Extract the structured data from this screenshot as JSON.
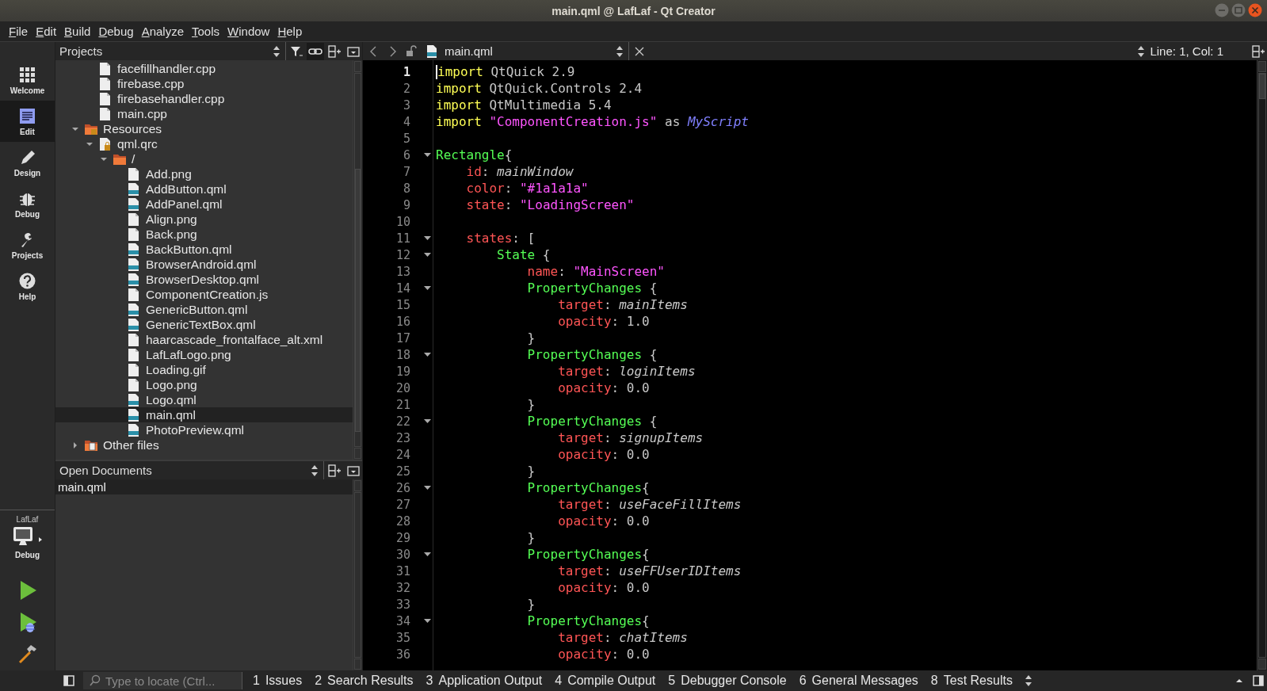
{
  "window": {
    "title": "main.qml @ LafLaf - Qt Creator"
  },
  "menu": [
    "File",
    "Edit",
    "Build",
    "Debug",
    "Analyze",
    "Tools",
    "Window",
    "Help"
  ],
  "modes": [
    {
      "label": "Welcome",
      "kind": "welcome",
      "selected": false
    },
    {
      "label": "Edit",
      "kind": "edit",
      "selected": true
    },
    {
      "label": "Design",
      "kind": "design",
      "selected": false
    },
    {
      "label": "Debug",
      "kind": "debug",
      "selected": false
    },
    {
      "label": "Projects",
      "kind": "projects",
      "selected": false
    },
    {
      "label": "Help",
      "kind": "help",
      "selected": false
    }
  ],
  "target": {
    "project": "LafLaf",
    "build": "Debug"
  },
  "projects_panel": {
    "title": "Projects",
    "tree": [
      {
        "children": [
          {
            "label": "facefillhandler.cpp",
            "kind": "file",
            "selected": false
          },
          {
            "label": "firebase.cpp",
            "kind": "file",
            "selected": false
          },
          {
            "label": "firebasehandler.cpp",
            "kind": "file",
            "selected": false
          },
          {
            "label": "main.cpp",
            "kind": "file",
            "selected": false
          }
        ]
      },
      {
        "label": "Resources",
        "kind": "resources",
        "selected": false,
        "expanded": true,
        "children": [
          {
            "label": "qml.qrc",
            "kind": "qrc",
            "selected": false,
            "expanded": true,
            "children": [
              {
                "label": "/",
                "kind": "folder",
                "selected": false,
                "expanded": true,
                "children": [
                  {
                    "label": "Add.png",
                    "kind": "file",
                    "selected": false
                  },
                  {
                    "label": "AddButton.qml",
                    "kind": "qml",
                    "selected": false
                  },
                  {
                    "label": "AddPanel.qml",
                    "kind": "qml",
                    "selected": false
                  },
                  {
                    "label": "Align.png",
                    "kind": "file",
                    "selected": false
                  },
                  {
                    "label": "Back.png",
                    "kind": "file",
                    "selected": false
                  },
                  {
                    "label": "BackButton.qml",
                    "kind": "qml",
                    "selected": false
                  },
                  {
                    "label": "BrowserAndroid.qml",
                    "kind": "qml",
                    "selected": false
                  },
                  {
                    "label": "BrowserDesktop.qml",
                    "kind": "qml",
                    "selected": false
                  },
                  {
                    "label": "ComponentCreation.js",
                    "kind": "file",
                    "selected": false
                  },
                  {
                    "label": "GenericButton.qml",
                    "kind": "qml",
                    "selected": false
                  },
                  {
                    "label": "GenericTextBox.qml",
                    "kind": "qml",
                    "selected": false
                  },
                  {
                    "label": "haarcascade_frontalface_alt.xml",
                    "kind": "file",
                    "selected": false
                  },
                  {
                    "label": "LafLafLogo.png",
                    "kind": "file",
                    "selected": false
                  },
                  {
                    "label": "Loading.gif",
                    "kind": "file",
                    "selected": false
                  },
                  {
                    "label": "Logo.png",
                    "kind": "file",
                    "selected": false
                  },
                  {
                    "label": "Logo.qml",
                    "kind": "qml",
                    "selected": false
                  },
                  {
                    "label": "main.qml",
                    "kind": "qml",
                    "selected": true
                  },
                  {
                    "label": "PhotoPreview.qml",
                    "kind": "qml",
                    "selected": false
                  }
                ]
              }
            ]
          }
        ]
      },
      {
        "label": "Other files",
        "kind": "other",
        "selected": false,
        "expanded": false
      }
    ]
  },
  "open_documents": {
    "title": "Open Documents",
    "items": [
      {
        "label": "main.qml",
        "selected": true
      }
    ]
  },
  "editor": {
    "file": "main.qml",
    "position": "Line: 1, Col: 1",
    "lines": [
      {
        "number": "1",
        "current": true,
        "fold": false,
        "segments": [
          {
            "text": "import",
            "color": "#ffff55"
          },
          {
            "text": " QtQuick 2.9",
            "color": "#c8c8c8"
          }
        ]
      },
      {
        "number": "2",
        "current": false,
        "fold": false,
        "segments": [
          {
            "text": "import",
            "color": "#ffff55"
          },
          {
            "text": " QtQuick.Controls 2.4",
            "color": "#c8c8c8"
          }
        ]
      },
      {
        "number": "3",
        "current": false,
        "fold": false,
        "segments": [
          {
            "text": "import",
            "color": "#ffff55"
          },
          {
            "text": " QtMultimedia 5.4",
            "color": "#c8c8c8"
          }
        ]
      },
      {
        "number": "4",
        "current": false,
        "fold": false,
        "segments": [
          {
            "text": "import",
            "color": "#ffff55"
          },
          {
            "text": " \"ComponentCreation.js\"",
            "color": "#ff55ff"
          },
          {
            "text": " as ",
            "color": "#c8c8c8"
          },
          {
            "text": "*MyScript*",
            "color": "#8080ff"
          }
        ]
      },
      {
        "number": "5",
        "current": false,
        "fold": false
      },
      {
        "number": "6",
        "current": false,
        "fold": true,
        "segments": [
          {
            "text": "Rectangle",
            "color": "#55ff55"
          },
          {
            "text": "{",
            "color": "#c8c8c8"
          }
        ]
      },
      {
        "number": "7",
        "current": false,
        "fold": false,
        "segments": [
          {
            "text": "    id",
            "color": "#ff5555"
          },
          {
            "text": ": *mainWindow*",
            "color": "#c8c8c8"
          }
        ]
      },
      {
        "number": "8",
        "current": false,
        "fold": false,
        "segments": [
          {
            "text": "    color",
            "color": "#ff5555"
          },
          {
            "text": ":",
            "color": "#c8c8c8"
          },
          {
            "text": " \"#1a1a1a\"",
            "color": "#ff55ff"
          }
        ]
      },
      {
        "number": "9",
        "current": false,
        "fold": false,
        "segments": [
          {
            "text": "    state",
            "color": "#ff5555"
          },
          {
            "text": ":",
            "color": "#c8c8c8"
          },
          {
            "text": " \"LoadingScreen\"",
            "color": "#ff55ff"
          }
        ]
      },
      {
        "number": "10",
        "current": false,
        "fold": false
      },
      {
        "number": "11",
        "current": false,
        "fold": true,
        "segments": [
          {
            "text": "    states",
            "color": "#ff5555"
          },
          {
            "text": ": [",
            "color": "#c8c8c8"
          }
        ]
      },
      {
        "number": "12",
        "current": false,
        "fold": true,
        "segments": [
          {
            "text": "        State",
            "color": "#55ff55"
          },
          {
            "text": " {",
            "color": "#c8c8c8"
          }
        ]
      },
      {
        "number": "13",
        "current": false,
        "fold": false,
        "segments": [
          {
            "text": "            name",
            "color": "#ff5555"
          },
          {
            "text": ":",
            "color": "#c8c8c8"
          },
          {
            "text": " \"MainScreen\"",
            "color": "#ff55ff"
          }
        ]
      },
      {
        "number": "14",
        "current": false,
        "fold": true,
        "segments": [
          {
            "text": "            PropertyChanges",
            "color": "#55ff55"
          },
          {
            "text": " {",
            "color": "#c8c8c8"
          }
        ]
      },
      {
        "number": "15",
        "current": false,
        "fold": false,
        "segments": [
          {
            "text": "                target",
            "color": "#ff5555"
          },
          {
            "text": ": *mainItems*",
            "color": "#c8c8c8"
          }
        ]
      },
      {
        "number": "16",
        "current": false,
        "fold": false,
        "segments": [
          {
            "text": "                opacity",
            "color": "#ff5555"
          },
          {
            "text": ": 1.0",
            "color": "#c8c8c8"
          }
        ]
      },
      {
        "number": "17",
        "current": false,
        "fold": false,
        "segments": [
          {
            "text": "            }",
            "color": "#c8c8c8"
          }
        ]
      },
      {
        "number": "18",
        "current": false,
        "fold": true,
        "segments": [
          {
            "text": "            PropertyChanges",
            "color": "#55ff55"
          },
          {
            "text": " {",
            "color": "#c8c8c8"
          }
        ]
      },
      {
        "number": "19",
        "current": false,
        "fold": false,
        "segments": [
          {
            "text": "                target",
            "color": "#ff5555"
          },
          {
            "text": ": *loginItems*",
            "color": "#c8c8c8"
          }
        ]
      },
      {
        "number": "20",
        "current": false,
        "fold": false,
        "segments": [
          {
            "text": "                opacity",
            "color": "#ff5555"
          },
          {
            "text": ": 0.0",
            "color": "#c8c8c8"
          }
        ]
      },
      {
        "number": "21",
        "current": false,
        "fold": false,
        "segments": [
          {
            "text": "            }",
            "color": "#c8c8c8"
          }
        ]
      },
      {
        "number": "22",
        "current": false,
        "fold": true,
        "segments": [
          {
            "text": "            PropertyChanges",
            "color": "#55ff55"
          },
          {
            "text": " {",
            "color": "#c8c8c8"
          }
        ]
      },
      {
        "number": "23",
        "current": false,
        "fold": false,
        "segments": [
          {
            "text": "                target",
            "color": "#ff5555"
          },
          {
            "text": ": *signupItems*",
            "color": "#c8c8c8"
          }
        ]
      },
      {
        "number": "24",
        "current": false,
        "fold": false,
        "segments": [
          {
            "text": "                opacity",
            "color": "#ff5555"
          },
          {
            "text": ": 0.0",
            "color": "#c8c8c8"
          }
        ]
      },
      {
        "number": "25",
        "current": false,
        "fold": false,
        "segments": [
          {
            "text": "            }",
            "color": "#c8c8c8"
          }
        ]
      },
      {
        "number": "26",
        "current": false,
        "fold": true,
        "segments": [
          {
            "text": "            PropertyChanges",
            "color": "#55ff55"
          },
          {
            "text": "{",
            "color": "#c8c8c8"
          }
        ]
      },
      {
        "number": "27",
        "current": false,
        "fold": false,
        "segments": [
          {
            "text": "                target",
            "color": "#ff5555"
          },
          {
            "text": ": *useFaceFillItems*",
            "color": "#c8c8c8"
          }
        ]
      },
      {
        "number": "28",
        "current": false,
        "fold": false,
        "segments": [
          {
            "text": "                opacity",
            "color": "#ff5555"
          },
          {
            "text": ": 0.0",
            "color": "#c8c8c8"
          }
        ]
      },
      {
        "number": "29",
        "current": false,
        "fold": false,
        "segments": [
          {
            "text": "            }",
            "color": "#c8c8c8"
          }
        ]
      },
      {
        "number": "30",
        "current": false,
        "fold": true,
        "segments": [
          {
            "text": "            PropertyChanges",
            "color": "#55ff55"
          },
          {
            "text": "{",
            "color": "#c8c8c8"
          }
        ]
      },
      {
        "number": "31",
        "current": false,
        "fold": false,
        "segments": [
          {
            "text": "                target",
            "color": "#ff5555"
          },
          {
            "text": ": *useFFUserIDItems*",
            "color": "#c8c8c8"
          }
        ]
      },
      {
        "number": "32",
        "current": false,
        "fold": false,
        "segments": [
          {
            "text": "                opacity",
            "color": "#ff5555"
          },
          {
            "text": ": 0.0",
            "color": "#c8c8c8"
          }
        ]
      },
      {
        "number": "33",
        "current": false,
        "fold": false,
        "segments": [
          {
            "text": "            }",
            "color": "#c8c8c8"
          }
        ]
      },
      {
        "number": "34",
        "current": false,
        "fold": true,
        "segments": [
          {
            "text": "            PropertyChanges",
            "color": "#55ff55"
          },
          {
            "text": "{",
            "color": "#c8c8c8"
          }
        ]
      },
      {
        "number": "35",
        "current": false,
        "fold": false,
        "segments": [
          {
            "text": "                target",
            "color": "#ff5555"
          },
          {
            "text": ": *chatItems*",
            "color": "#c8c8c8"
          }
        ]
      },
      {
        "number": "36",
        "current": false,
        "fold": false,
        "segments": [
          {
            "text": "                opacity",
            "color": "#ff5555"
          },
          {
            "text": ": 0.0",
            "color": "#c8c8c8"
          }
        ]
      }
    ]
  },
  "status_bar": {
    "locator_placeholder": "Type to locate (Ctrl...",
    "tabs": [
      {
        "number": "1",
        "label": "Issues"
      },
      {
        "number": "2",
        "label": "Search Results"
      },
      {
        "number": "3",
        "label": "Application Output"
      },
      {
        "number": "4",
        "label": "Compile Output"
      },
      {
        "number": "5",
        "label": "Debugger Console"
      },
      {
        "number": "6",
        "label": "General Messages"
      },
      {
        "number": "8",
        "label": "Test Results"
      }
    ]
  }
}
